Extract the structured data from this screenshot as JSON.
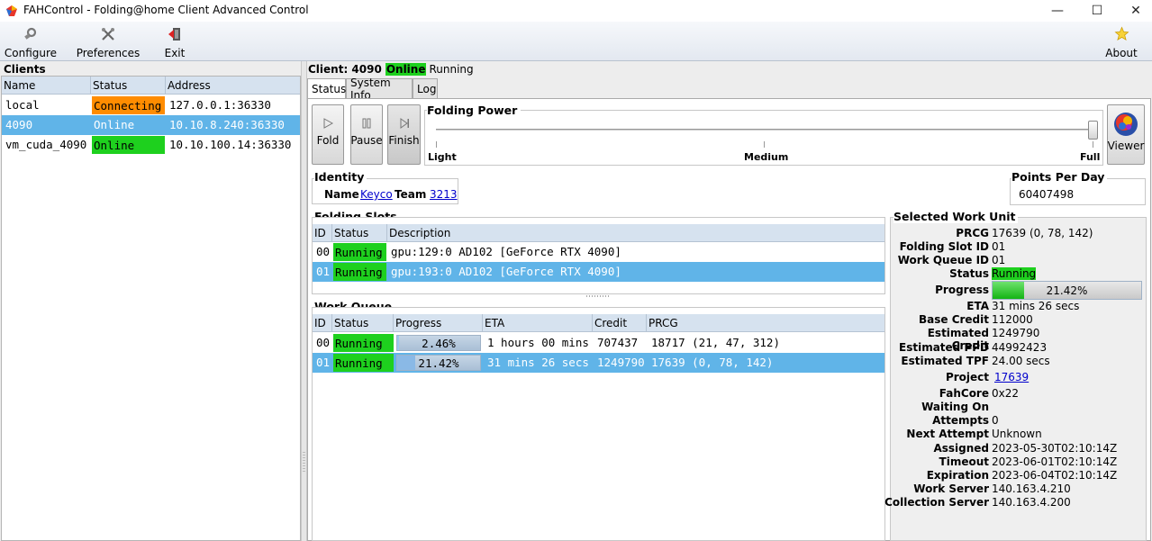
{
  "window": {
    "title": "FAHControl - Folding@home Client Advanced Control",
    "minimize_glyph": "—",
    "maximize_glyph": "☐",
    "close_glyph": "✕"
  },
  "toolbar": {
    "configure": "Configure",
    "preferences": "Preferences",
    "exit": "Exit",
    "about": "About"
  },
  "clients": {
    "title": "Clients",
    "columns": [
      "Name",
      "Status",
      "Address"
    ],
    "rows": [
      {
        "name": "local",
        "status": "Connecting",
        "address": "127.0.0.1:36330",
        "status_color": "#ff8c00"
      },
      {
        "name": "4090",
        "status": "Online",
        "address": "10.10.8.240:36330",
        "status_color": "#60b4e8"
      },
      {
        "name": "vm_cuda_4090",
        "status": "Online",
        "address": "10.10.100.14:36330",
        "status_color": "#1ed01e"
      }
    ]
  },
  "client_header": {
    "prefix": "Client: 4090",
    "online": "Online",
    "running": "Running"
  },
  "tabs": [
    "Status",
    "System Info",
    "Log"
  ],
  "controls": {
    "fold": "Fold",
    "pause": "Pause",
    "finish": "Finish",
    "viewer": "Viewer"
  },
  "folding_power": {
    "title": "Folding Power",
    "light": "Light",
    "medium": "Medium",
    "full": "Full",
    "level": 1.0
  },
  "identity": {
    "title": "Identity",
    "name_label": "Name",
    "name": "Keyco",
    "team_label": "Team",
    "team": "3213"
  },
  "ppd": {
    "title": "Points Per Day",
    "value": "60407498"
  },
  "slots": {
    "title": "Folding Slots",
    "columns": [
      "ID",
      "Status",
      "Description"
    ],
    "rows": [
      {
        "id": "00",
        "status": "Running",
        "description": "gpu:129:0 AD102 [GeForce RTX 4090]"
      },
      {
        "id": "01",
        "status": "Running",
        "description": "gpu:193:0 AD102 [GeForce RTX 4090]"
      }
    ]
  },
  "queue": {
    "title": "Work Queue",
    "columns": [
      "ID",
      "Status",
      "Progress",
      "ETA",
      "Credit",
      "PRCG"
    ],
    "rows": [
      {
        "id": "00",
        "status": "Running",
        "progress": "2.46%",
        "progress_value": 0.0246,
        "eta": "1 hours 00 mins",
        "credit": "707437",
        "prcg": "18717 (21, 47, 312)"
      },
      {
        "id": "01",
        "status": "Running",
        "progress": "21.42%",
        "progress_value": 0.2142,
        "eta": "31 mins 26 secs",
        "credit": "1249790",
        "prcg": "17639 (0, 78, 142)"
      }
    ]
  },
  "swu": {
    "title": "Selected Work Unit",
    "prcg_label": "PRCG",
    "prcg": "17639 (0, 78, 142)",
    "slot_label": "Folding Slot ID",
    "slot": "01",
    "queue_label": "Work Queue ID",
    "queue": "01",
    "status_label": "Status",
    "status": "Running",
    "progress_label": "Progress",
    "progress": "21.42%",
    "progress_value": 0.2142,
    "eta_label": "ETA",
    "eta": "31 mins 26 secs",
    "base_label": "Base Credit",
    "base": "112000",
    "estc_label": "Estimated Credit",
    "estc": "1249790",
    "ppd_label": "Estimated PPD",
    "ppd": "44992423",
    "tpf_label": "Estimated TPF",
    "tpf": "24.00 secs",
    "project_label": "Project",
    "project": "17639",
    "core_label": "FahCore",
    "core": "0x22",
    "waiting_label": "Waiting On",
    "waiting": "",
    "attempts_label": "Attempts",
    "attempts": "0",
    "next_label": "Next Attempt",
    "next": "Unknown",
    "assigned_label": "Assigned",
    "assigned": "2023-05-30T02:10:14Z",
    "timeout_label": "Timeout",
    "timeout": "2023-06-01T02:10:14Z",
    "expiration_label": "Expiration",
    "expiration": "2023-06-04T02:10:14Z",
    "ws_label": "Work Server",
    "ws": "140.163.4.210",
    "cs_label": "Collection Server",
    "cs": "140.163.4.200"
  },
  "colors": {
    "running_green": "#1ed01e",
    "connecting_orange": "#ff8c00",
    "selection_blue": "#60b4e8",
    "header_blue": "#d6e2ef"
  }
}
